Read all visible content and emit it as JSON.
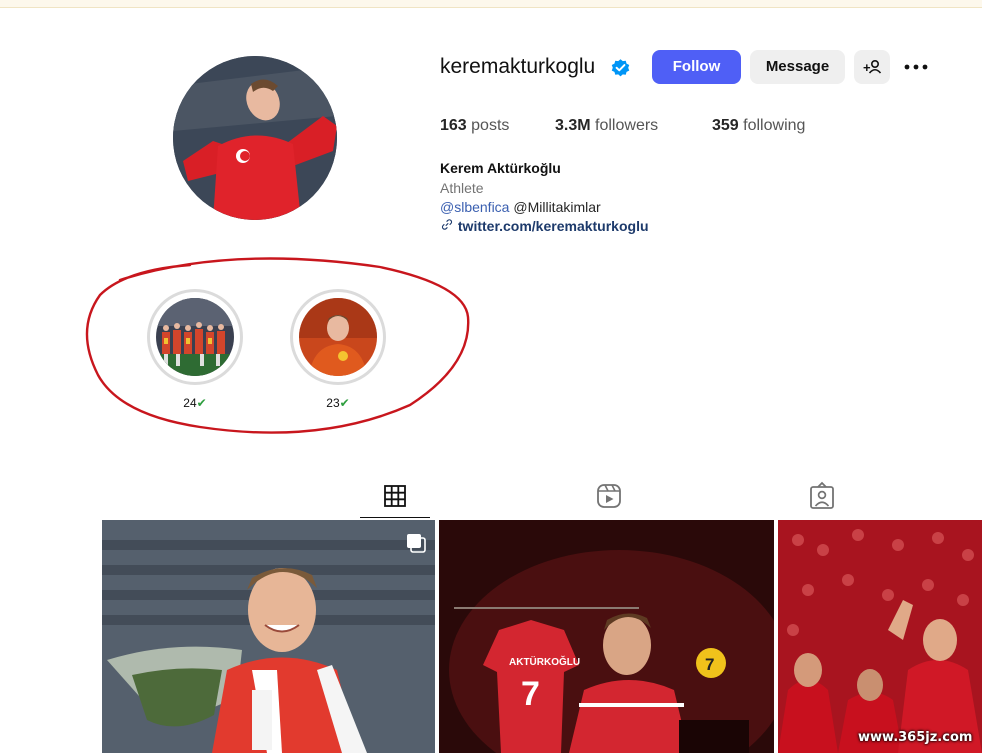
{
  "profile": {
    "username": "keremakturkoglu",
    "full_name": "Kerem Aktürkoğlu",
    "category": "Athlete",
    "bio_mention_1": "@slbenfica",
    "bio_mention_2": "@Millitakimlar",
    "link": "twitter.com/keremakturkoglu"
  },
  "buttons": {
    "follow": "Follow",
    "message": "Message",
    "add_user": "+♙",
    "more": "•••"
  },
  "stats": {
    "posts_count": "163",
    "posts_label": "posts",
    "followers_count": "3.3M",
    "followers_label": "followers",
    "following_count": "359",
    "following_label": "following"
  },
  "highlights": [
    {
      "label": "24",
      "check": "✔"
    },
    {
      "label": "23",
      "check": "✔"
    }
  ],
  "tabs": [
    "posts-grid",
    "reels",
    "tagged"
  ],
  "watermark": "www.365jz.com",
  "colors": {
    "follow_button": "#4f5ff6",
    "verified_badge": "#0095f6",
    "annotation_circle": "#c8161d"
  }
}
